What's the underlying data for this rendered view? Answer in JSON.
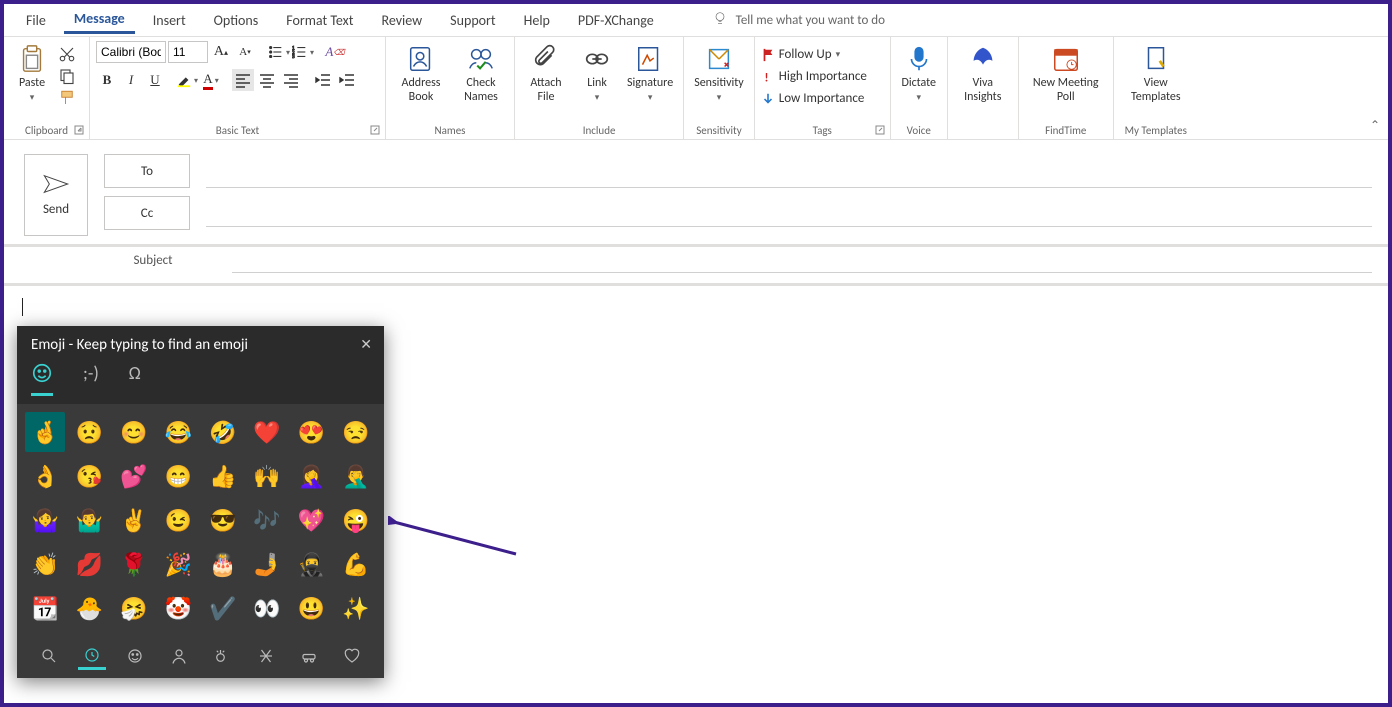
{
  "tabs": {
    "file": "File",
    "message": "Message",
    "insert": "Insert",
    "options": "Options",
    "format_text": "Format Text",
    "review": "Review",
    "support": "Support",
    "help": "Help",
    "pdf": "PDF-XChange"
  },
  "tell_me": "Tell me what you want to do",
  "ribbon": {
    "clipboard": {
      "label": "Clipboard",
      "paste": "Paste"
    },
    "basic_text": {
      "label": "Basic Text",
      "font_name": "Calibri (Body)",
      "font_size": "11"
    },
    "names": {
      "label": "Names",
      "address": "Address Book",
      "check": "Check Names"
    },
    "include": {
      "label": "Include",
      "attach": "Attach File",
      "link": "Link",
      "signature": "Signature"
    },
    "sensitivity": {
      "label": "Sensitivity",
      "btn": "Sensitivity"
    },
    "tags": {
      "label": "Tags",
      "follow": "Follow Up",
      "high": "High Importance",
      "low": "Low Importance"
    },
    "voice": {
      "label": "Voice",
      "dictate": "Dictate"
    },
    "viva": {
      "label": "",
      "btn": "Viva Insights"
    },
    "findtime": {
      "label": "FindTime",
      "btn": "New Meeting Poll"
    },
    "templates": {
      "label": "My Templates",
      "btn": "View Templates"
    }
  },
  "compose": {
    "send": "Send",
    "to": "To",
    "cc": "Cc",
    "subject": "Subject"
  },
  "emoji": {
    "title": "Emoji - Keep typing to find an emoji",
    "tab_kaomoji": ";-)",
    "tab_symbols": "Ω",
    "grid": [
      "🤞",
      "😟",
      "😊",
      "😂",
      "🤣",
      "❤️",
      "😍",
      "😒",
      "👌",
      "😘",
      "💕",
      "😁",
      "👍",
      "🙌",
      "🤦‍♀️",
      "🤦‍♂️",
      "🤷‍♀️",
      "🤷‍♂️",
      "✌️",
      "😉",
      "😎",
      "🎶",
      "💖",
      "😜",
      "👏",
      "💋",
      "🌹",
      "🎉",
      "🎂",
      "🤳",
      "🥷",
      "💪",
      "📆",
      "🐣",
      "🤧",
      "🤡",
      "✔️",
      "👀",
      "😃",
      "✨"
    ]
  }
}
